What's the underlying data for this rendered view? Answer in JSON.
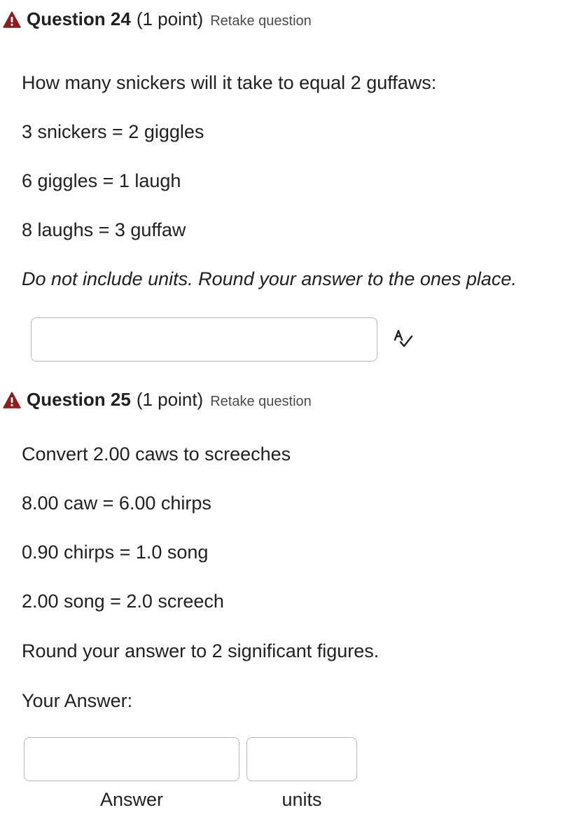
{
  "questions": [
    {
      "title": "Question 24",
      "points": "(1 point)",
      "retake": "Retake question",
      "lines": [
        "How many snickers will it take to equal 2 guffaws:",
        "3 snickers = 2 giggles",
        "6 giggles = 1 laugh",
        "8 laughs = 3 guffaw"
      ],
      "instruction": "Do not include units.  Round your answer to the ones place.",
      "answer_value": "",
      "icons": {
        "status": "warning-icon",
        "tool": "spell-check-icon"
      }
    },
    {
      "title": "Question 25",
      "points": "(1 point)",
      "retake": "Retake question",
      "lines": [
        "Convert 2.00 caws to screeches",
        "8.00 caw = 6.00 chirps",
        "0.90 chirps = 1.0 song",
        "2.00 song = 2.0 screech",
        "Round your answer to 2 significant figures.",
        "Your Answer:"
      ],
      "answer_value": "",
      "units_value": "",
      "answer_label": "Answer",
      "units_label": "units",
      "icons": {
        "status": "warning-icon"
      }
    }
  ],
  "colors": {
    "warning": "#8f1d1d",
    "text": "#202122",
    "link": "#494c4e",
    "input_border": "#b6b9bd"
  }
}
